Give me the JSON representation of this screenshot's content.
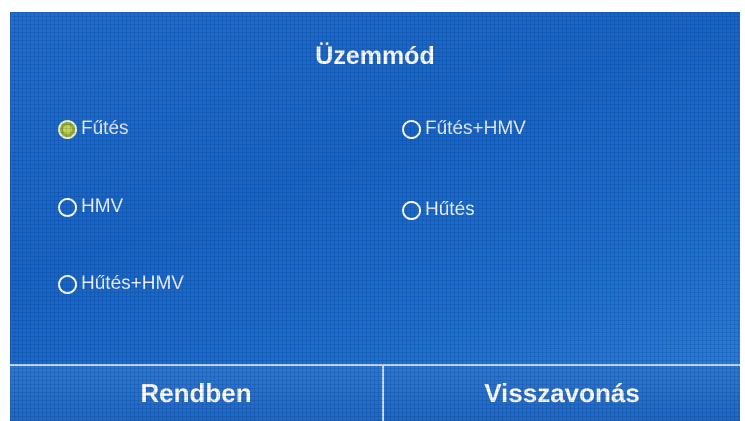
{
  "dialog": {
    "title": "Üzemmód"
  },
  "options": [
    {
      "label": "Fűtés",
      "selected": true
    },
    {
      "label": "Fűtés+HMV",
      "selected": false
    },
    {
      "label": "HMV",
      "selected": false
    },
    {
      "label": "Hűtés",
      "selected": false
    },
    {
      "label": "Hűtés+HMV",
      "selected": false
    }
  ],
  "buttons": {
    "ok_label": "Rendben",
    "cancel_label": "Visszavonás"
  },
  "colors": {
    "background": "#1565c8",
    "selected_radio": "#8fae3a",
    "text": "#ffffff"
  }
}
